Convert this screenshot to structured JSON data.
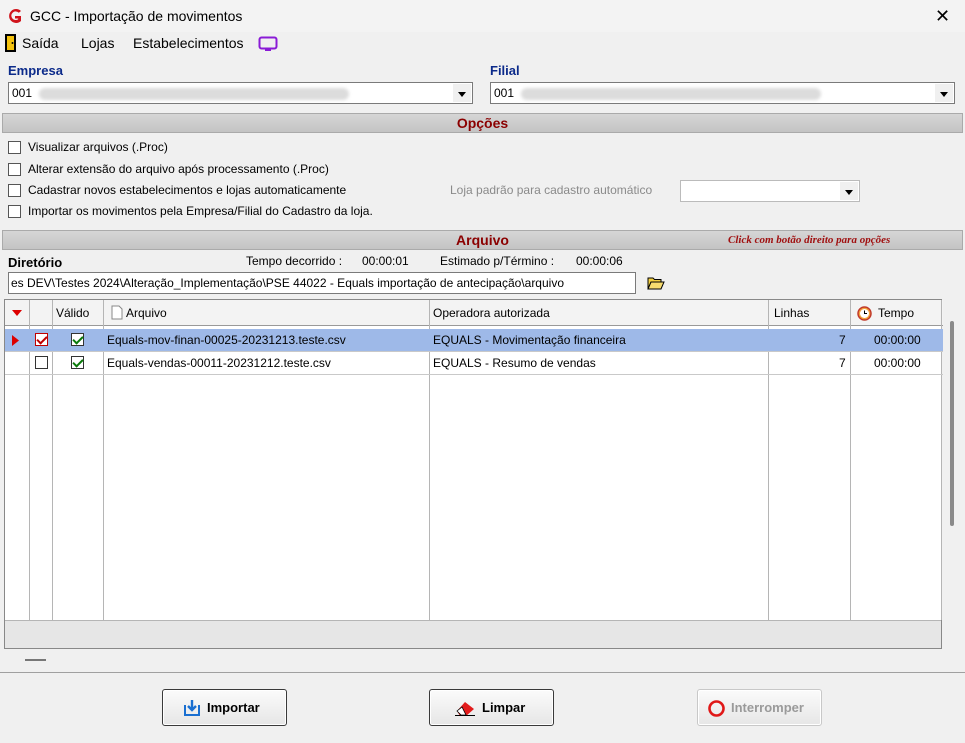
{
  "window": {
    "title": "GCC - Importação de movimentos",
    "close": "✕"
  },
  "menu": {
    "exit": "Saída",
    "stores": "Lojas",
    "establishments": "Estabelecimentos"
  },
  "company": {
    "label": "Empresa",
    "value": "001"
  },
  "branch": {
    "label": "Filial",
    "value": "001"
  },
  "options": {
    "header": "Opções",
    "view_files": "Visualizar arquivos (.Proc)",
    "change_ext": "Alterar extensão do arquivo após processamento (.Proc)",
    "register_new": "Cadastrar novos estabelecimentos e lojas automaticamente",
    "import_by": "Importar os movimentos pela Empresa/Filial do Cadastro da loja.",
    "default_store_label": "Loja padrão para cadastro automático"
  },
  "file": {
    "header": "Arquivo",
    "hint": "Click com botão direito para opções",
    "dir_label": "Diretório",
    "elapsed_label": "Tempo decorrido :",
    "elapsed_value": "00:00:01",
    "estimate_label": "Estimado p/Término :",
    "estimate_value": "00:00:06",
    "path": "es DEV\\Testes 2024\\Alteração_Implementação\\PSE 44022 - Equals importação de antecipação\\arquivo"
  },
  "grid": {
    "headers": {
      "valid": "Válido",
      "file": "Arquivo",
      "operator": "Operadora autorizada",
      "lines": "Linhas",
      "time": "Tempo"
    },
    "rows": [
      {
        "file": "Equals-mov-finan-00025-20231213.teste.csv",
        "operator": "EQUALS - Movimentação financeira",
        "lines": "7",
        "time": "00:00:00"
      },
      {
        "file": "Equals-vendas-00011-20231212.teste.csv",
        "operator": "EQUALS - Resumo de vendas",
        "lines": "7",
        "time": "00:00:00"
      }
    ]
  },
  "buttons": {
    "import": "Importar",
    "clear": "Limpar",
    "stop": "Interromper"
  }
}
